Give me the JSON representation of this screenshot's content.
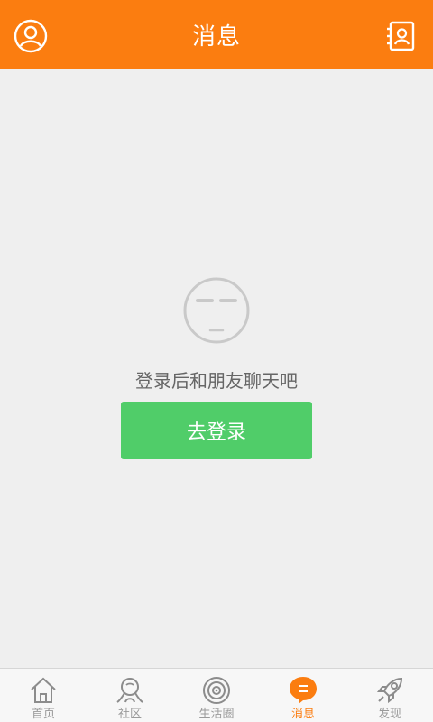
{
  "header": {
    "title": "消息",
    "left_icon": "profile-icon",
    "right_icon": "contacts-icon"
  },
  "empty_state": {
    "icon": "neutral-face-icon",
    "message": "登录后和朋友聊天吧",
    "login_label": "去登录"
  },
  "tabbar": {
    "items": [
      {
        "label": "首页",
        "icon": "home-icon"
      },
      {
        "label": "社区",
        "icon": "community-icon"
      },
      {
        "label": "生活圈",
        "icon": "life-circle-icon"
      },
      {
        "label": "消息",
        "icon": "message-icon"
      },
      {
        "label": "发现",
        "icon": "rocket-icon"
      }
    ],
    "active_index": 3
  },
  "colors": {
    "accent": "#fb7d10",
    "login_button": "#50cd69",
    "background": "#efefef"
  }
}
